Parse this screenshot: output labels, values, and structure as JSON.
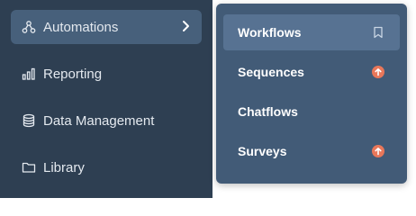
{
  "sidebar": {
    "items": [
      {
        "label": "Automations",
        "icon": "automations-icon",
        "active": true
      },
      {
        "label": "Reporting",
        "icon": "bar-chart-icon"
      },
      {
        "label": "Data Management",
        "icon": "database-icon"
      },
      {
        "label": "Library",
        "icon": "folder-icon"
      }
    ]
  },
  "flyout": {
    "items": [
      {
        "label": "Workflows",
        "trailing_icon": "bookmark-icon",
        "highlighted": true
      },
      {
        "label": "Sequences",
        "trailing_icon": "upgrade-arrow-icon"
      },
      {
        "label": "Chatflows"
      },
      {
        "label": "Surveys",
        "trailing_icon": "upgrade-arrow-icon"
      }
    ]
  },
  "colors": {
    "sidebar_bg": "#2e3f52",
    "active_item_bg": "#47607b",
    "flyout_bg": "#425b77",
    "flyout_hover_bg": "#577292",
    "upgrade_badge": "#e8775a"
  }
}
